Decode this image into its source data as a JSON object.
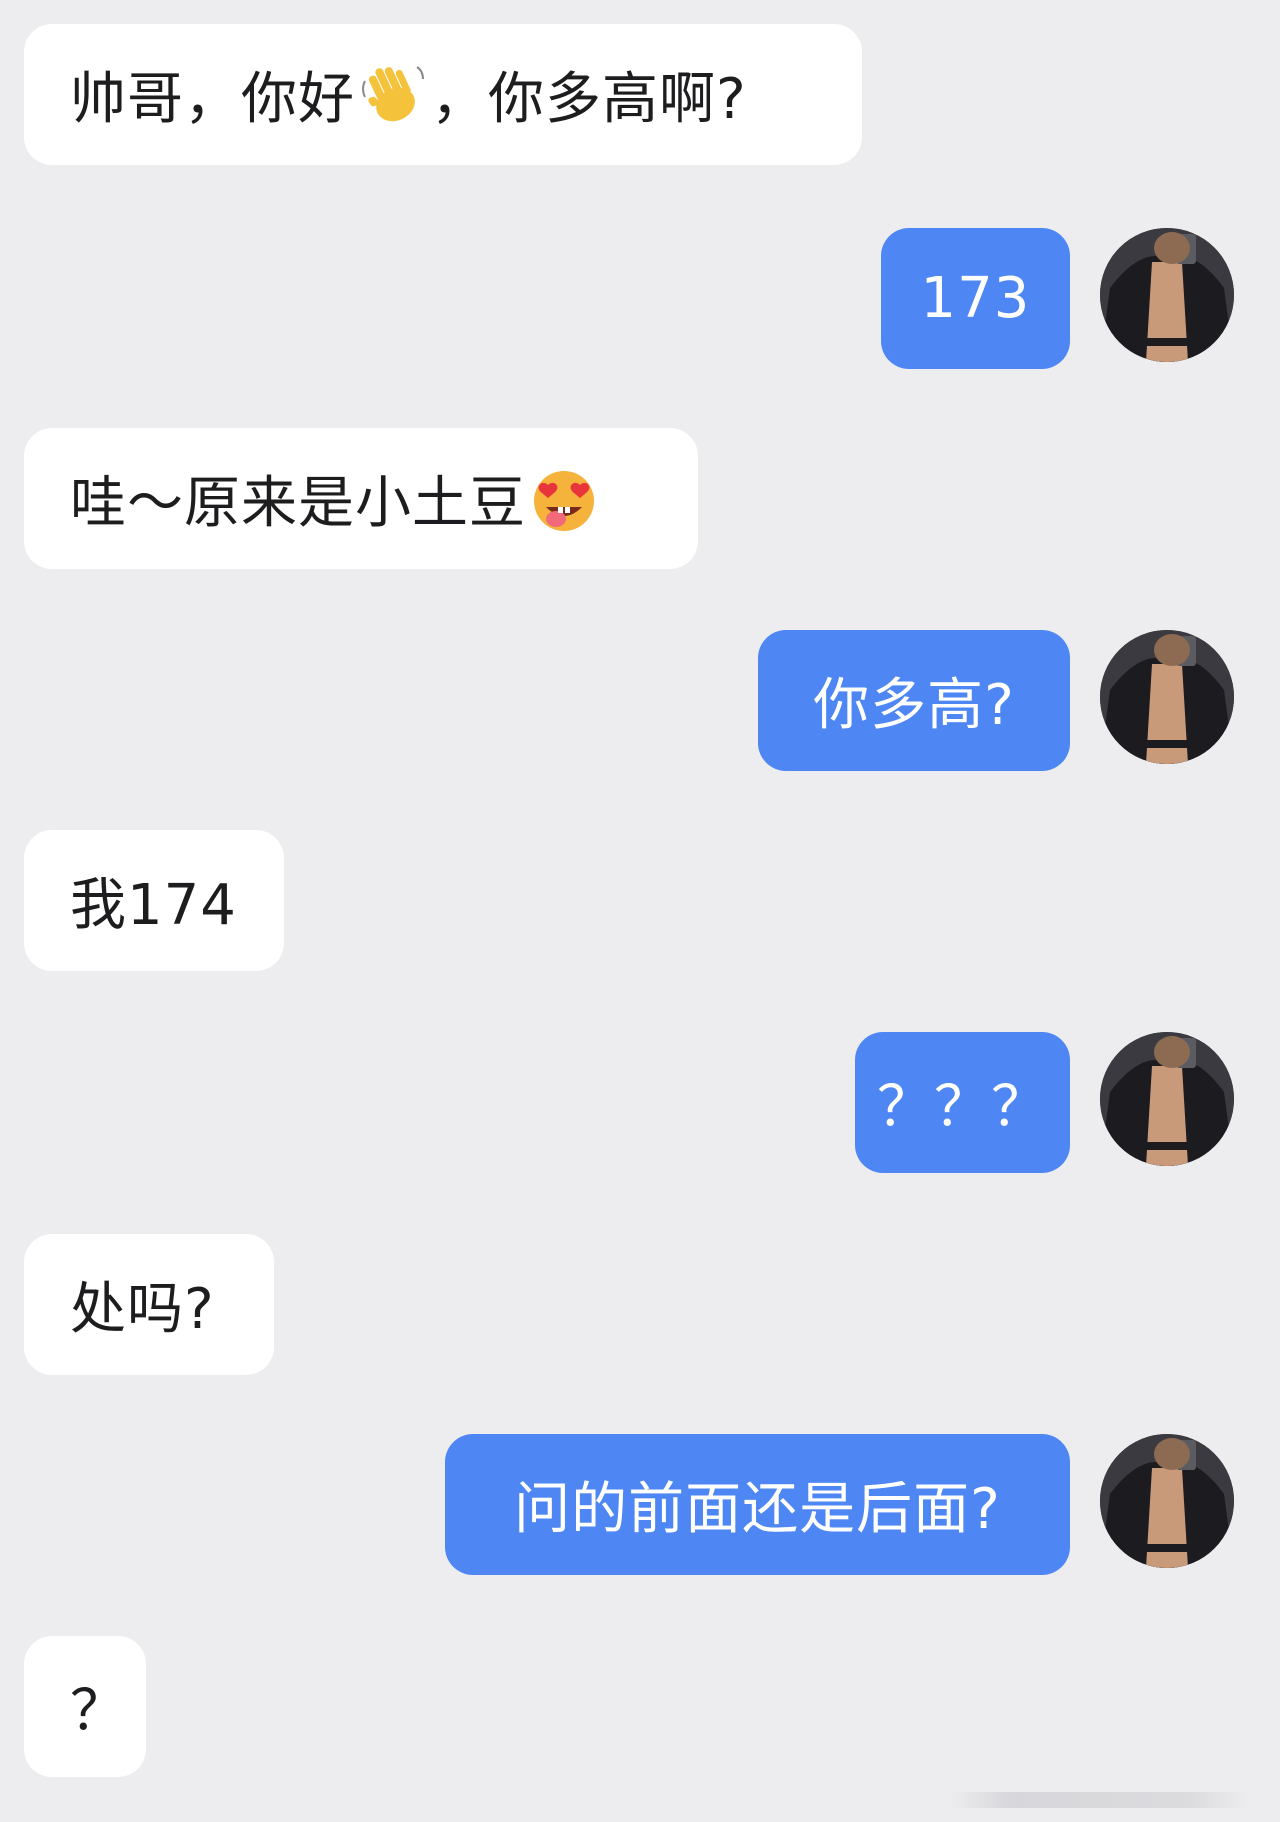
{
  "messages": [
    {
      "side": "in",
      "parts": [
        "帅哥，你好",
        "，你多高啊?"
      ],
      "emoji": "waving-hand-emoji"
    },
    {
      "side": "out",
      "text": "173"
    },
    {
      "side": "in",
      "parts": [
        "哇～原来是小土豆"
      ],
      "emoji": "heart-eyes-tongue-emoji"
    },
    {
      "side": "out",
      "text": "你多高?"
    },
    {
      "side": "in",
      "text": "我174"
    },
    {
      "side": "out",
      "text": "？？？"
    },
    {
      "side": "in",
      "text": "处吗?"
    },
    {
      "side": "out",
      "text": "问的前面还是后面?"
    },
    {
      "side": "in",
      "text": "？"
    }
  ],
  "colors": {
    "background": "#ededef",
    "incoming_bubble": "#ffffff",
    "outgoing_bubble": "#4e86f4",
    "incoming_text": "#1d1d1f",
    "outgoing_text": "#ffffff"
  }
}
